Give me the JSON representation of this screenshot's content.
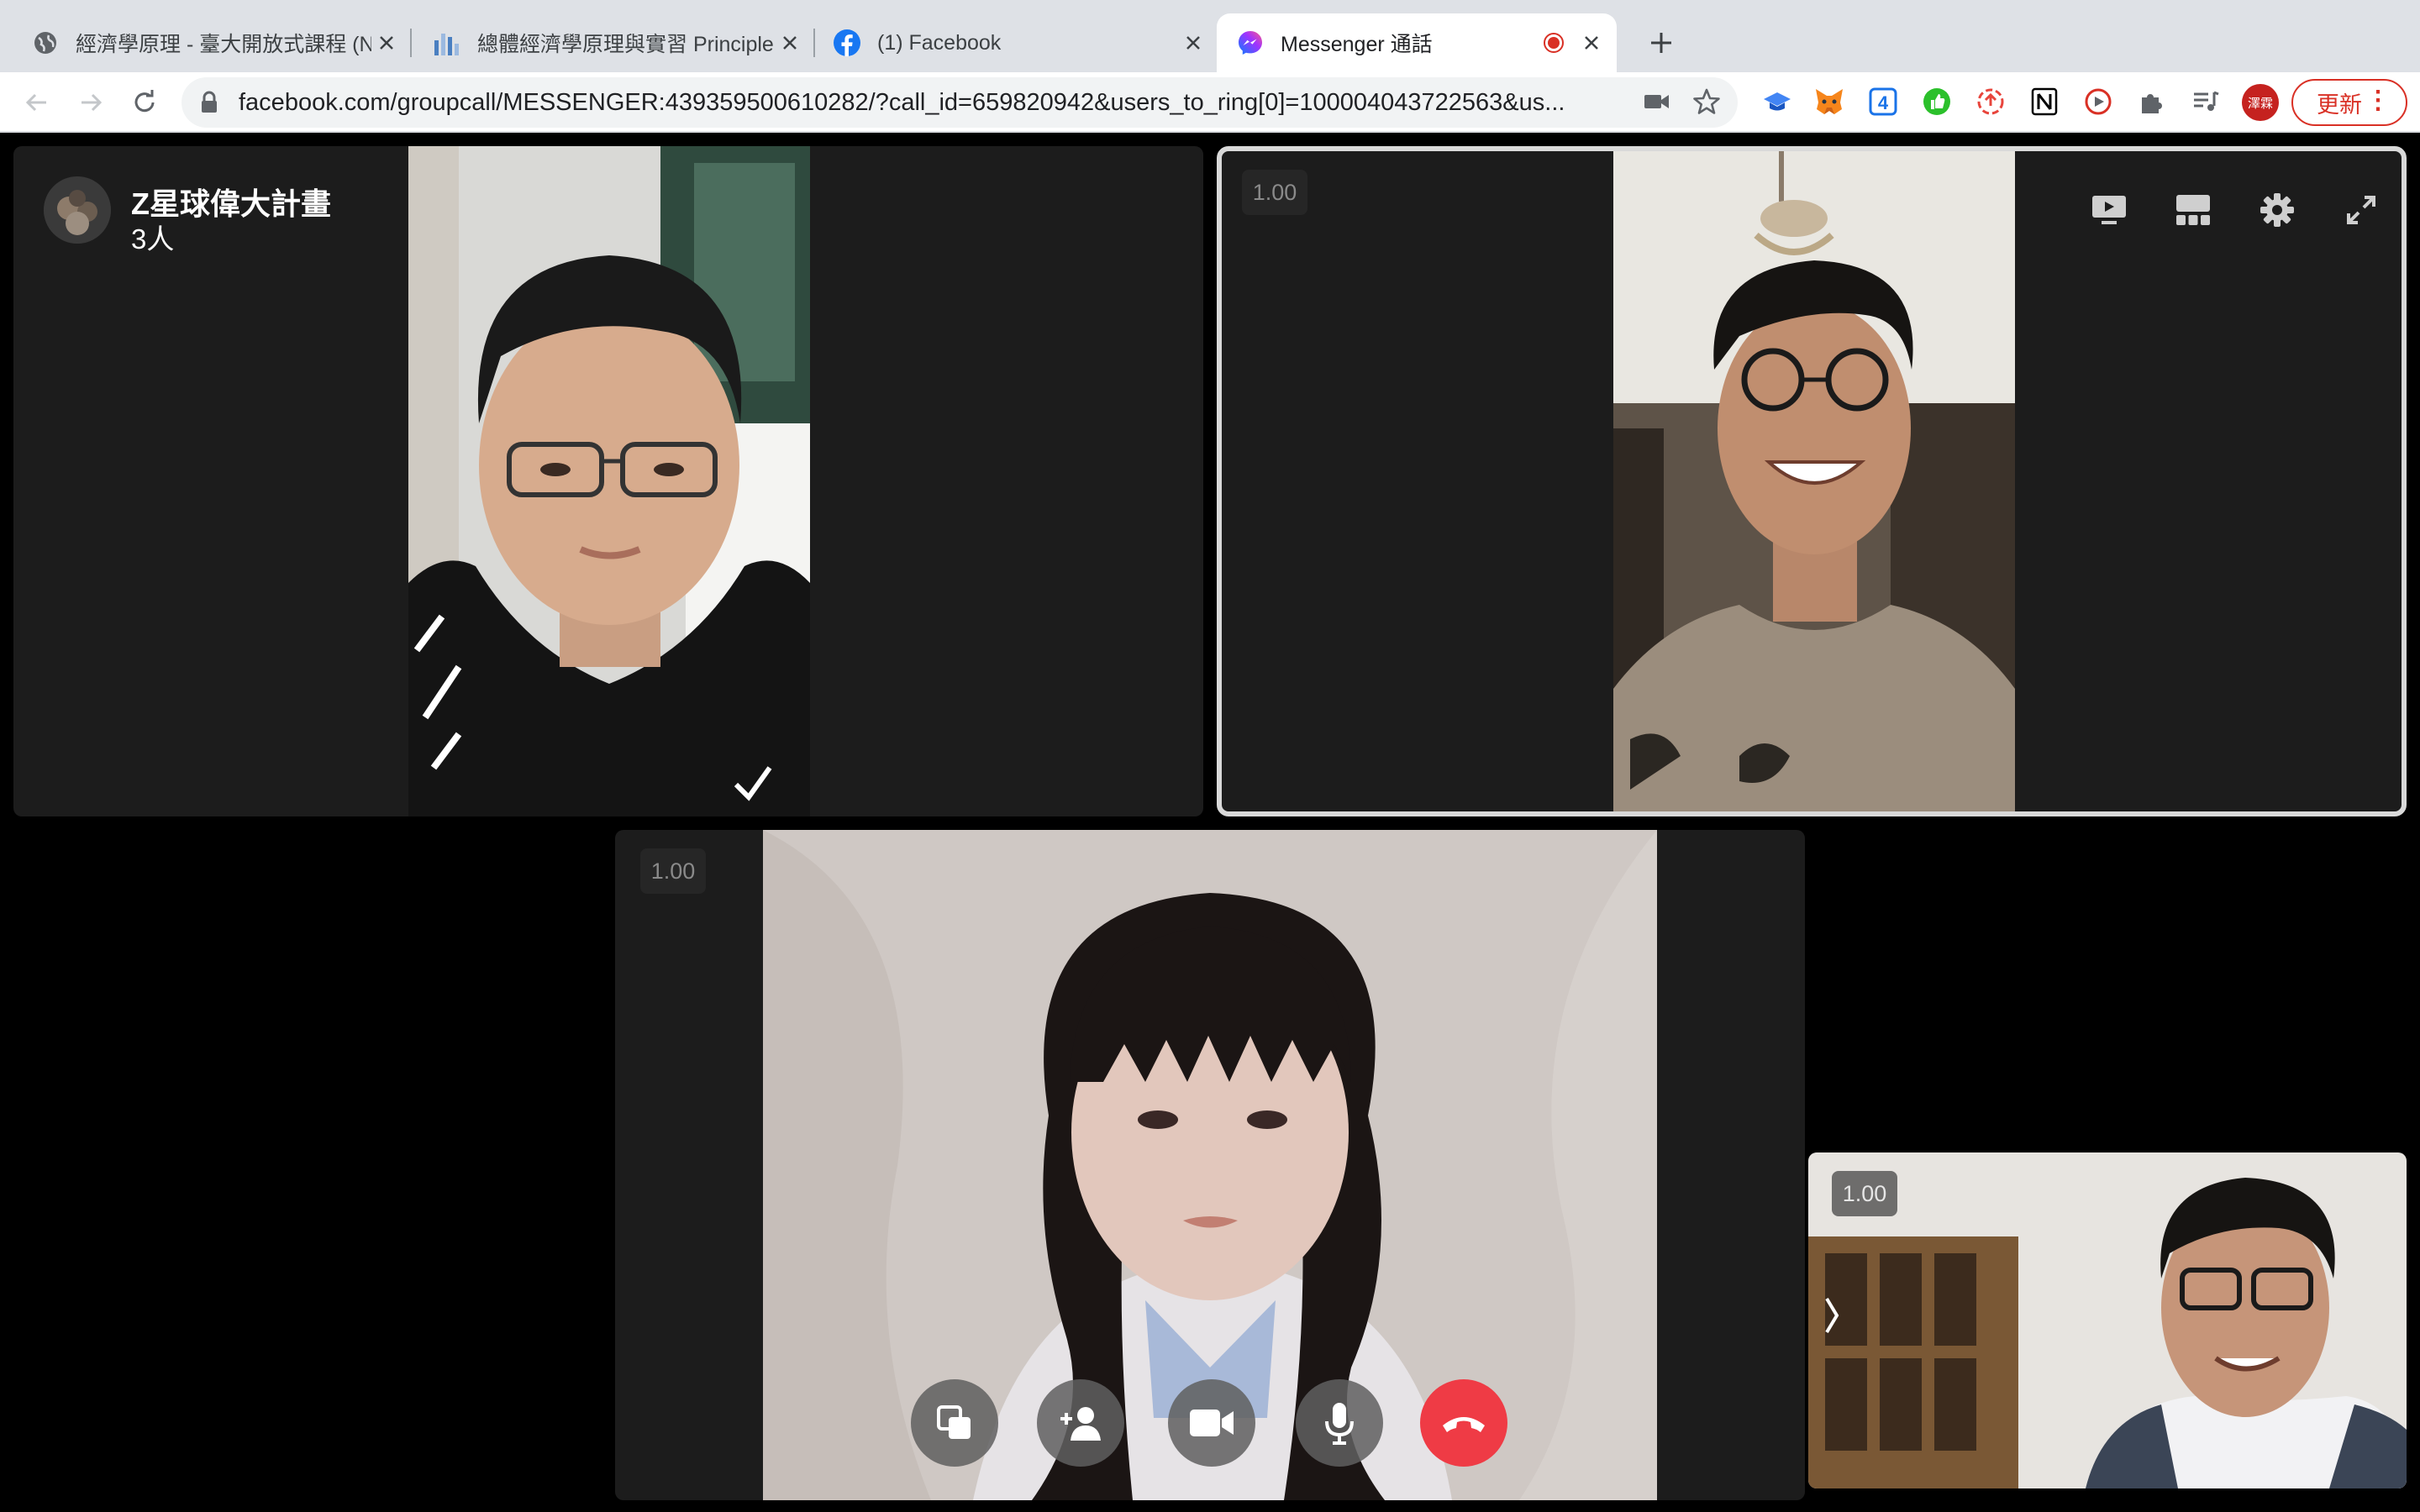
{
  "tabs": [
    {
      "title": "經濟學原理 - 臺大開放式課程 (N",
      "icon": "globe-icon"
    },
    {
      "title": "總體經濟學原理與實習 Principle",
      "icon": "bar-chart-icon"
    },
    {
      "title": "(1) Facebook",
      "icon": "facebook-icon"
    },
    {
      "title": "Messenger 通話",
      "icon": "messenger-icon",
      "active": true,
      "recording": true
    }
  ],
  "toolbar": {
    "url": "facebook.com/groupcall/MESSENGER:439359500610282/?call_id=659820942&users_to_ring[0]=100004043722563&us...",
    "profile_initials": "澤霖",
    "update_label": "更新",
    "extensions": [
      "metamask-fox-icon",
      "graduation-cap-icon",
      "calendar-4-icon",
      "green-thumb-icon",
      "screen-record-icon",
      "notion-icon",
      "screen-capture-icon",
      "puzzle-icon",
      "media-playlist-icon"
    ]
  },
  "call": {
    "group_name": "Z星球偉大計畫",
    "participant_count": "3人",
    "level_top_right": "1.00",
    "level_bottom_center": "1.00",
    "level_self_view": "1.00",
    "top_controls": [
      "screen-share-icon",
      "grid-layout-icon",
      "gear-icon",
      "expand-icon"
    ],
    "bottom_controls": [
      "switch-view-icon",
      "add-person-icon",
      "video-camera-icon",
      "microphone-icon",
      "end-call-icon"
    ],
    "colors": {
      "end_call": "#ef3b45",
      "active_speaker_border": "#d9d9d9",
      "panel_bg": "#1c1c1c"
    }
  }
}
